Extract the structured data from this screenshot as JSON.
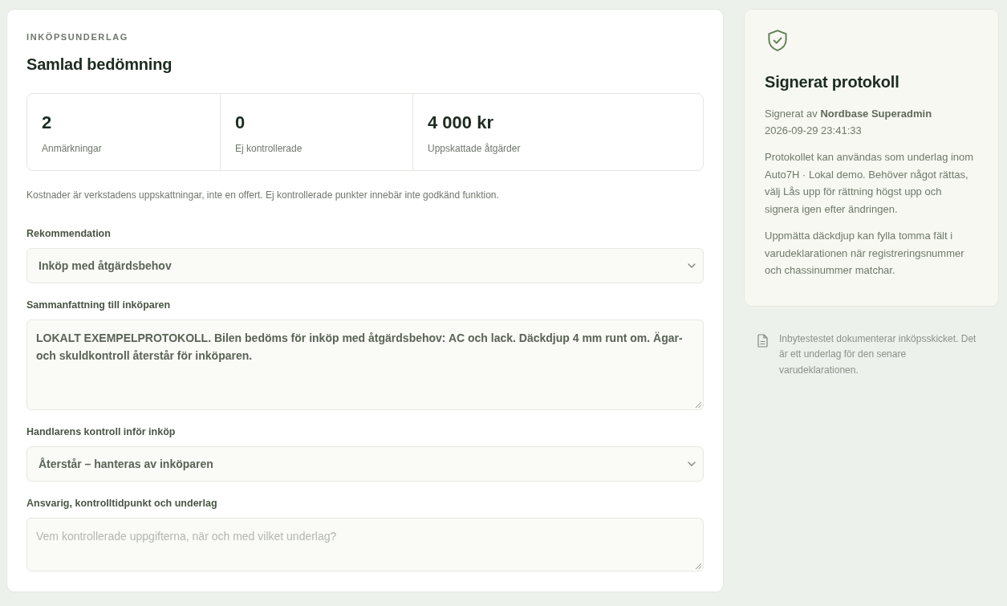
{
  "assessment": {
    "eyebrow": "INKÖPSUNDERLAG",
    "title": "Samlad bedömning",
    "stats": [
      {
        "value": "2",
        "label": "Anmärkningar"
      },
      {
        "value": "0",
        "label": "Ej kontrollerade"
      },
      {
        "value": "4 000 kr",
        "label": "Uppskattade åtgärder"
      }
    ],
    "note": "Kostnader är verkstadens uppskattningar, inte en offert. Ej kontrollerade punkter innebär inte godkänd funktion.",
    "fields": [
      {
        "kind": "select",
        "label": "Rekommendation",
        "value": "Inköp med åtgärdsbehov"
      },
      {
        "kind": "textarea",
        "label": "Sammanfattning till inköparen",
        "value": "LOKALT EXEMPELPROTOKOLL. Bilen bedöms för inköp med åtgärdsbehov: AC och lack. Däckdjup 4 mm runt om. Ägar- och skuldkontroll återstår för inköparen."
      },
      {
        "kind": "select",
        "label": "Handlarens kontroll inför inköp",
        "value": "Återstår – hanteras av inköparen"
      },
      {
        "kind": "textarea",
        "label": "Ansvarig, kontrolltidpunkt och underlag",
        "placeholder": "Vem kontrollerade uppgifterna, när och med vilket underlag?"
      }
    ]
  },
  "signed_card": {
    "title": "Signerat protokoll",
    "signed_by": "Signerat av **Nordbase Superadmin**",
    "timestamp": "2026-09-29 23:41:33",
    "paragraphs": [
      "Protokollet kan användas som underlag inom Auto7H · Lokal demo. Behöver något rättas, välj Lås upp för rättning högst upp och signera igen efter ändringen.",
      "Uppmätta däckdjup kan fylla tomma fält i varudeklarationen när registreringsnummer och chassinummer matchar."
    ]
  },
  "info_note": {
    "text": "Inbytestestet dokumenterar inköpsskicket. Det är ett underlag för den senare varudeklarationen."
  }
}
